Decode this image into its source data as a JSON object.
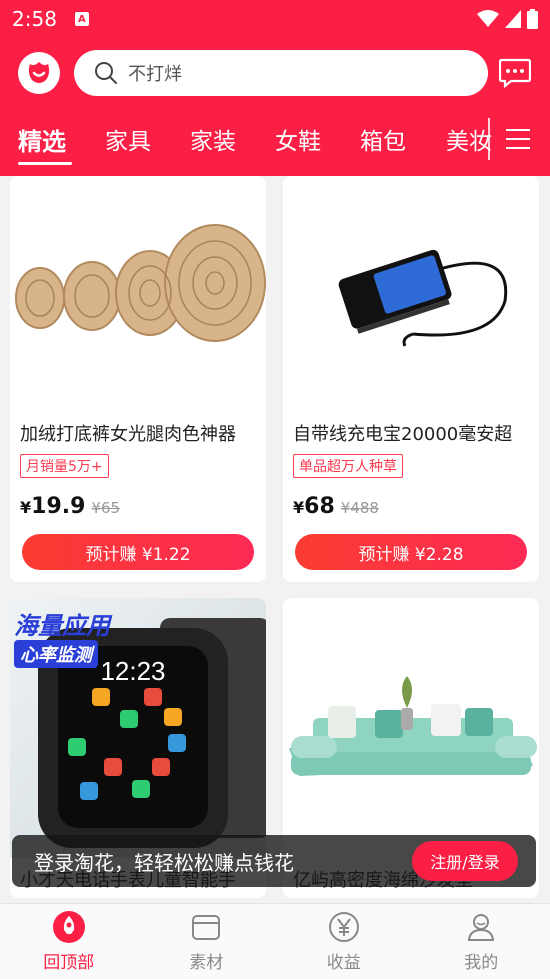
{
  "status": {
    "time": "2:58"
  },
  "search": {
    "placeholder": "不打烊"
  },
  "tabs": [
    {
      "label": "精选",
      "active": true
    },
    {
      "label": "家具"
    },
    {
      "label": "家装"
    },
    {
      "label": "女鞋"
    },
    {
      "label": "箱包"
    },
    {
      "label": "美妆"
    }
  ],
  "products": [
    {
      "title": "加绒打底裤女光腿肉色神器",
      "tag": "月销量5万+",
      "currency": "¥",
      "price": "19.9",
      "original": "¥65",
      "earn": "预计赚 ¥1.22"
    },
    {
      "title": "自带线充电宝20000毫安超",
      "tag": "单品超万人种草",
      "currency": "¥",
      "price": "68",
      "original": "¥488",
      "earn": "预计赚 ¥2.28"
    },
    {
      "title": "小才天电话手表儿童智能手",
      "image_caption_1": "海量应用",
      "image_caption_2": "心率监测",
      "watch_time": "12:23"
    },
    {
      "title": "亿屿高密度海绵沙发垫"
    }
  ],
  "banner": {
    "text": "登录淘花，轻轻松松赚点钱花",
    "button": "注册/登录"
  },
  "nav": [
    {
      "label": "回顶部",
      "icon": "rocket-icon",
      "active": true
    },
    {
      "label": "素材",
      "icon": "folder-icon"
    },
    {
      "label": "收益",
      "icon": "yuan-icon"
    },
    {
      "label": "我的",
      "icon": "user-icon"
    }
  ],
  "colors": {
    "brand": "#fb1f46",
    "text": "#222222",
    "muted": "#8a8a8a"
  }
}
